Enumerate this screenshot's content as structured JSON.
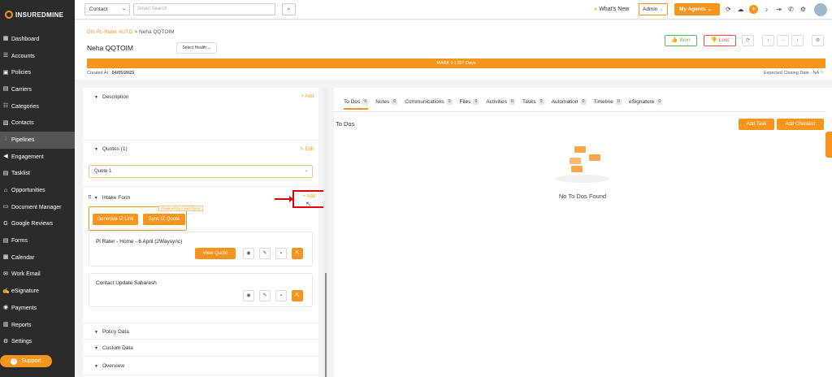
{
  "brand": {
    "name": "INSUREDMINE"
  },
  "sidebar": {
    "items": [
      {
        "label": "Dashboard",
        "icon": "dashboard-icon"
      },
      {
        "label": "Accounts",
        "icon": "accounts-icon"
      },
      {
        "label": "Policies",
        "icon": "policies-icon"
      },
      {
        "label": "Carriers",
        "icon": "carriers-icon"
      },
      {
        "label": "Categories",
        "icon": "categories-icon"
      },
      {
        "label": "Contacts",
        "icon": "contacts-icon"
      },
      {
        "label": "Pipelines",
        "icon": "pipelines-icon",
        "active": true
      },
      {
        "label": "Engagement",
        "icon": "engagement-icon"
      },
      {
        "label": "Tasklist",
        "icon": "tasklist-icon"
      },
      {
        "label": "Opportunities",
        "icon": "opportunities-icon"
      },
      {
        "label": "Document Manager",
        "icon": "document-icon"
      },
      {
        "label": "Google Reviews",
        "icon": "google-icon"
      },
      {
        "label": "Forms",
        "icon": "forms-icon"
      },
      {
        "label": "Calendar",
        "icon": "calendar-icon"
      },
      {
        "label": "Work Email",
        "icon": "email-icon"
      },
      {
        "label": "eSignature",
        "icon": "esignature-icon"
      },
      {
        "label": "Payments",
        "icon": "payments-icon"
      },
      {
        "label": "Reports",
        "icon": "reports-icon"
      },
      {
        "label": "Settings",
        "icon": "settings-icon"
      }
    ],
    "support_label": "Support"
  },
  "topbar": {
    "contact_select": "Contact",
    "search_placeholder": "Smart Search",
    "whats_new": "What's New",
    "admin": "Admin",
    "my_agents": "My Agents"
  },
  "header": {
    "breadcrumb_link": "DN PL-Rater AUTO",
    "breadcrumb_current": "Neha QQTOIM",
    "breadcrumb_sep": ">",
    "name": "Neha QQTOIM",
    "select_health": "Select Health",
    "won": "Won",
    "lost": "Lost",
    "stage": "MARK 1 | 207 Days",
    "created_label": "Created At :",
    "created_date": "04/05/2023",
    "closing": "Expected Closing Date : NA"
  },
  "left": {
    "description": "Description",
    "add": "+ Add",
    "quotes": "Quotes (1)",
    "edit": "Edit",
    "quote1": "Quote 1",
    "intake": "Intake Form",
    "powered": "Powered by InsureDynX",
    "generate": "Generate IZ Link",
    "sync": "Sync IZ Quote",
    "card1_title": "Pl Rater - Home - 6 April (2Waysync)",
    "view_quote": "View Quote",
    "card2_title": "Contact Update Sabaresh",
    "policy_data": "Policy Data",
    "custom_data": "Custom Data",
    "overview": "Overview"
  },
  "right": {
    "tabs": [
      {
        "label": "To Dos",
        "count": "0"
      },
      {
        "label": "Notes",
        "count": "0"
      },
      {
        "label": "Communications",
        "count": "0"
      },
      {
        "label": "Files",
        "count": "0"
      },
      {
        "label": "Activities",
        "count": "0"
      },
      {
        "label": "Tasks",
        "count": "0"
      },
      {
        "label": "Automation",
        "count": "0"
      },
      {
        "label": "Timeline",
        "count": "0"
      },
      {
        "label": "eSignature",
        "count": "0"
      }
    ],
    "title": "To Dos",
    "add_task": "Add Task",
    "add_checklist": "Add Checklist",
    "empty": "No To Dos Found"
  },
  "colors": {
    "accent": "#f7941d",
    "sidebar": "#2b2b2b",
    "highlight": "#e00000"
  }
}
